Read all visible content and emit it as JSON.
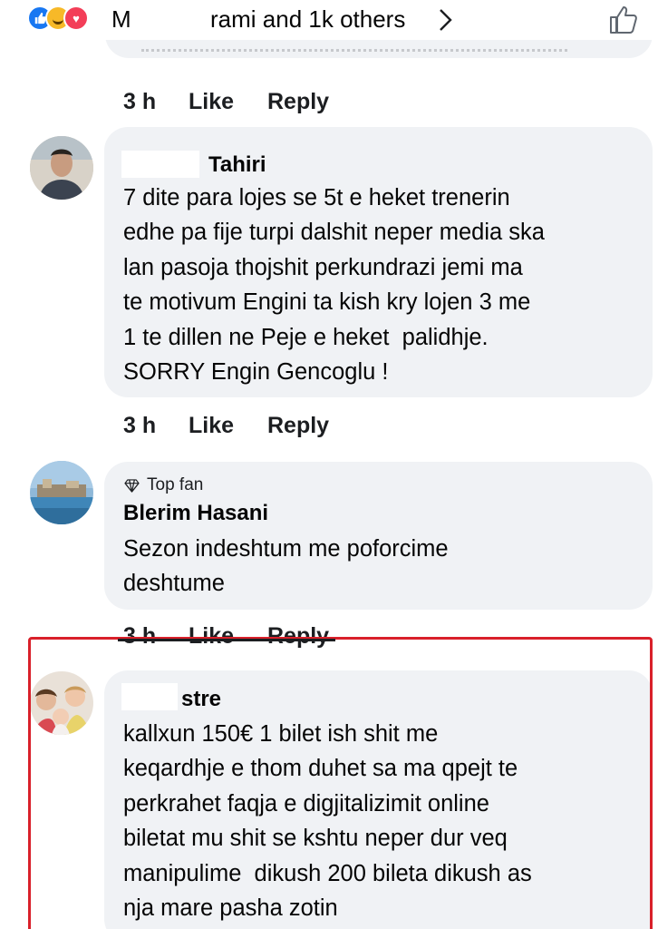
{
  "header": {
    "reactions": [
      "like-icon",
      "haha-icon",
      "love-icon"
    ],
    "name_initial": "M",
    "others_text": "rami and 1k others",
    "accent_color": "#1877f2"
  },
  "comments": [
    {
      "time": "3 h",
      "like_label": "Like",
      "reply_label": "Reply"
    },
    {
      "name": "Tahiri",
      "lines": [
        "7 dite para lojes se 5t e heket trenerin",
        "edhe pa fije turpi dalshit neper media ska",
        "lan pasoja thojshit perkundrazi jemi ma",
        "te motivum Engini ta kish kry lojen 3 me",
        "1 te dillen ne Peje e heket  palidhje.",
        "SORRY Engin Gencoglu !"
      ],
      "time": "3 h",
      "like_label": "Like",
      "reply_label": "Reply"
    },
    {
      "badge": "Top fan",
      "name": "Blerim Hasani",
      "lines": [
        "Sezon indeshtum me poforcime",
        "deshtume"
      ],
      "time": "3 h",
      "like_label": "Like",
      "reply_label": "Reply"
    },
    {
      "name": "stre",
      "lines": [
        "kallxun 150€ 1 bilet ish shit me",
        "keqardhje e thom duhet sa ma qpejt te",
        "perkrahet faqja e digjitalizimit online",
        "biletat mu shit se kshtu neper dur veq",
        "manipulime  dikush 200 bileta dikush as",
        "nja mare pasha zotin"
      ]
    }
  ],
  "highlight_color": "#d9202a"
}
